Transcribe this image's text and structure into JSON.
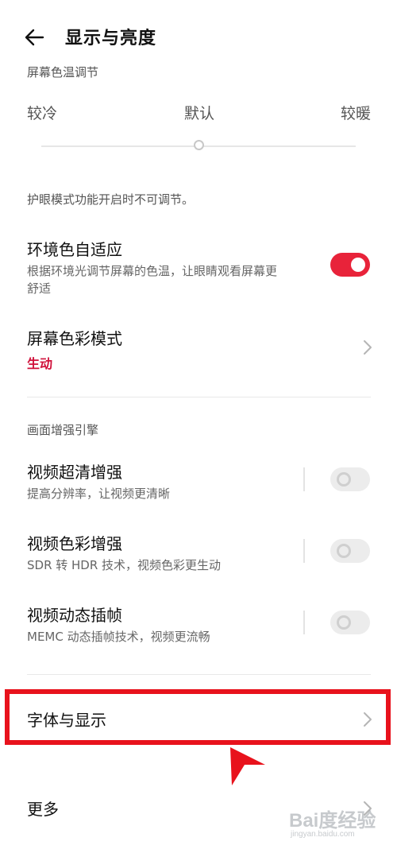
{
  "header": {
    "title": "显示与亮度"
  },
  "color_temp": {
    "section_label": "屏幕色温调节",
    "cold_label": "较冷",
    "default_label": "默认",
    "warm_label": "较暖",
    "slider_level": 0.5,
    "note": "护眼模式功能开启时不可调节。"
  },
  "ambient_adaptive": {
    "title": "环境色自适应",
    "desc_line1": "根据环境光调节屏幕的色温，让眼睛观看屏幕更",
    "desc_line2": "舒适",
    "enabled": true
  },
  "color_mode": {
    "title": "屏幕色彩模式",
    "value": "生动",
    "value_color": "#d0103a"
  },
  "enhance": {
    "section_label": "画面增强引擎",
    "items": [
      {
        "title": "视频超清增强",
        "desc": "提高分辨率，让视频更清晰",
        "enabled": false
      },
      {
        "title": "视频色彩增强",
        "desc": "SDR 转 HDR 技术，视频色彩更生动",
        "enabled": false
      },
      {
        "title": "视频动态插帧",
        "desc": "MEMC 动态插帧技术，视频更流畅",
        "enabled": false
      }
    ]
  },
  "font_display": {
    "title": "字体与显示"
  },
  "more": {
    "title": "更多"
  },
  "colors": {
    "accent": "#e8233a",
    "highlight": "#e8121c"
  },
  "watermark": {
    "text": "Bai度经验",
    "sub": "jingyan.baidu.com"
  }
}
